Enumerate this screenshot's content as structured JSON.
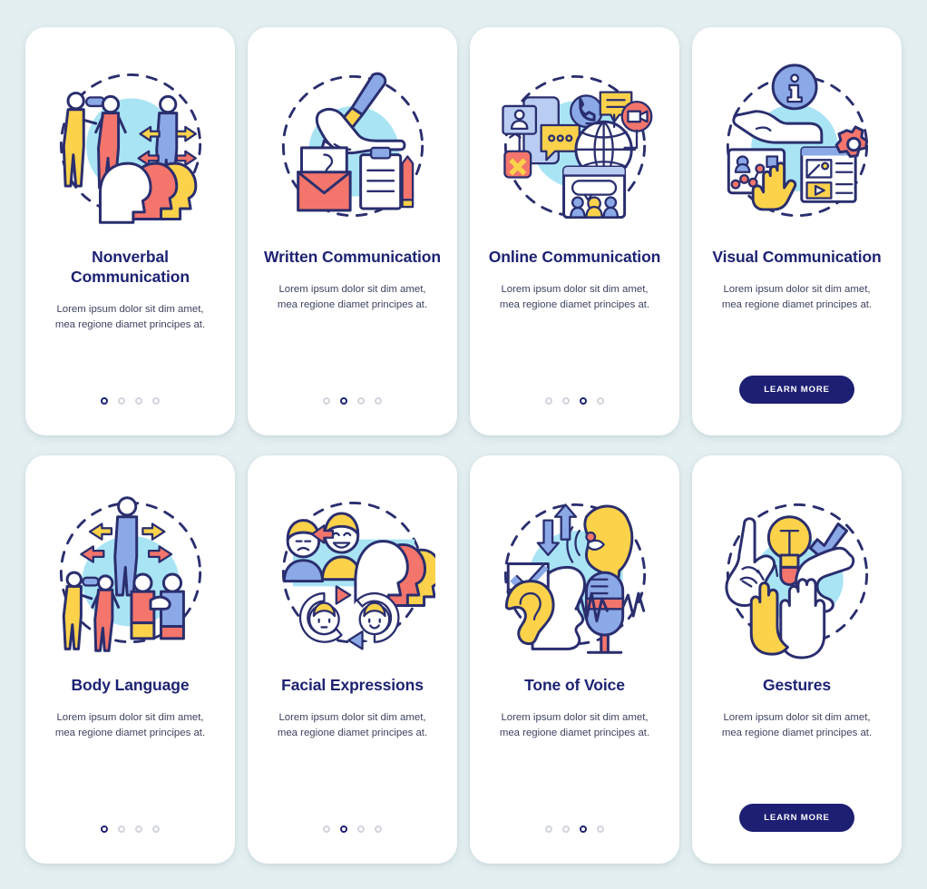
{
  "page": {
    "background_color": "#e4eff1",
    "card_background_color": "#ffffff",
    "title_color": "#1d2272",
    "body_color": "#3e4360",
    "accent_button_color": "#1d1f73",
    "dot_inactive_color": "#d2d4dd",
    "illustration_palette": {
      "yellow": "#fcd24b",
      "coral": "#f4756b",
      "blue": "#8aa9e6",
      "light_blue": "#b9cdf2",
      "cyan": "#a9e4f5",
      "outline_navy": "#2a2e6e"
    }
  },
  "body_text": "Lorem ipsum dolor sit dim amet, mea regione diamet principes at.",
  "learn_more_label": "LEARN MORE",
  "cards": [
    {
      "id": "nonverbal-communication",
      "title": "Nonverbal Communication",
      "body": "Lorem ipsum dolor sit dim amet, mea regione diamet principes at.",
      "illustration": "people-arrows-heads-icon",
      "footer": "dots",
      "dots": {
        "count": 4,
        "active_index": 0
      }
    },
    {
      "id": "written-communication",
      "title": "Written Communication",
      "body": "Lorem ipsum dolor sit dim amet, mea regione diamet principes at.",
      "illustration": "hand-pen-envelope-clipboard-icon",
      "footer": "dots",
      "dots": {
        "count": 4,
        "active_index": 1
      }
    },
    {
      "id": "online-communication",
      "title": "Online Communication",
      "body": "Lorem ipsum dolor sit dim amet, mea regione diamet principes at.",
      "illustration": "globe-chat-video-call-icon",
      "footer": "dots",
      "dots": {
        "count": 4,
        "active_index": 2
      }
    },
    {
      "id": "visual-communication",
      "title": "Visual Communication",
      "body": "Lorem ipsum dolor sit dim amet, mea regione diamet principes at.",
      "illustration": "info-hand-media-gear-icon",
      "footer": "button",
      "button_label": "LEARN MORE"
    },
    {
      "id": "body-language",
      "title": "Body Language",
      "body": "Lorem ipsum dolor sit dim amet, mea regione diamet principes at.",
      "illustration": "standing-people-arrows-icon",
      "footer": "dots",
      "dots": {
        "count": 4,
        "active_index": 0
      }
    },
    {
      "id": "facial-expressions",
      "title": "Facial Expressions",
      "body": "Lorem ipsum dolor sit dim amet, mea regione diamet principes at.",
      "illustration": "faces-emotions-cycle-icon",
      "footer": "dots",
      "dots": {
        "count": 4,
        "active_index": 1
      }
    },
    {
      "id": "tone-of-voice",
      "title": "Tone of Voice",
      "body": "Lorem ipsum dolor sit dim amet, mea regione diamet principes at.",
      "illustration": "microphone-ear-voice-icon",
      "footer": "dots",
      "dots": {
        "count": 4,
        "active_index": 2
      }
    },
    {
      "id": "gestures",
      "title": "Gestures",
      "body": "Lorem ipsum dolor sit dim amet, mea regione diamet principes at.",
      "illustration": "hands-lightbulb-check-icon",
      "footer": "button",
      "button_label": "LEARN MORE"
    }
  ]
}
